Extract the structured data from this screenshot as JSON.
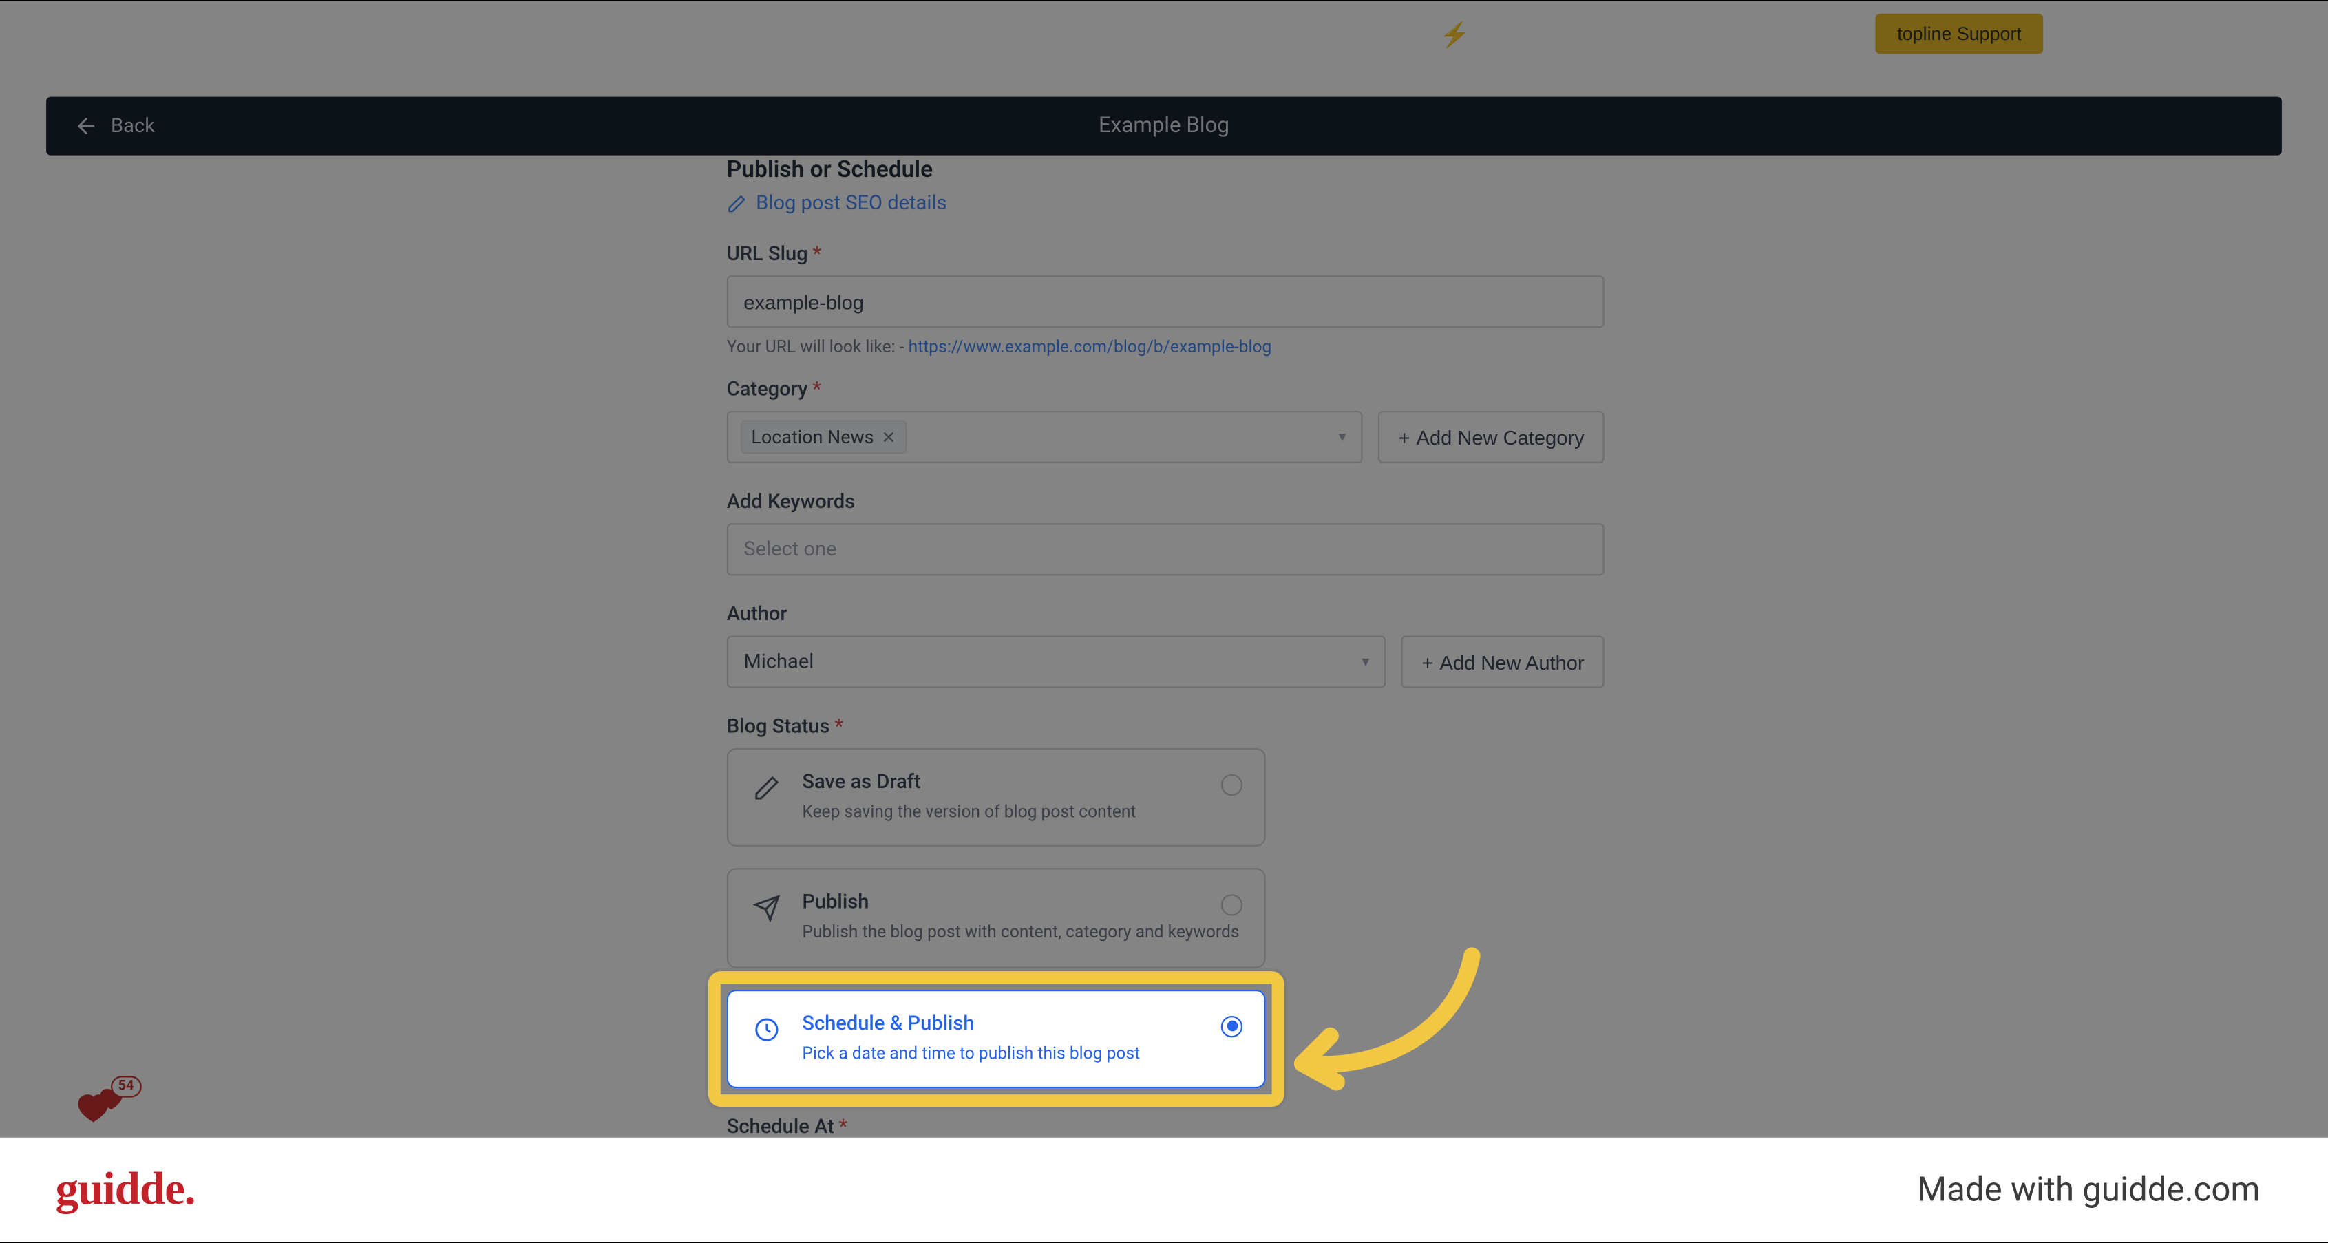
{
  "top": {
    "support_label": "topline Support"
  },
  "pageBar": {
    "back_label": "Back",
    "title": "Example Blog"
  },
  "form": {
    "section_title": "Publish or Schedule",
    "seo_link": "Blog post SEO details",
    "url_slug": {
      "label": "URL Slug",
      "value": "example-blog",
      "hint_prefix": "Your URL will look like: - ",
      "hint_url": "https://www.example.com/blog/b/example-blog"
    },
    "category": {
      "label": "Category",
      "chip": "Location News",
      "add_label": "Add New Category"
    },
    "keywords": {
      "label": "Add Keywords",
      "placeholder": "Select one"
    },
    "author": {
      "label": "Author",
      "value": "Michael",
      "add_label": "Add New Author"
    },
    "status": {
      "label": "Blog Status",
      "options": [
        {
          "title": "Save as Draft",
          "desc": "Keep saving the version of blog post content"
        },
        {
          "title": "Publish",
          "desc": "Publish the blog post with content, category and keywords"
        },
        {
          "title": "Schedule & Publish",
          "desc": "Pick a date and time to publish this blog post"
        }
      ]
    },
    "schedule_at": {
      "label": "Schedule At"
    }
  },
  "hearts": {
    "count": "54"
  },
  "footer": {
    "logo": "guidde.",
    "credit": "Made with guidde.com"
  }
}
